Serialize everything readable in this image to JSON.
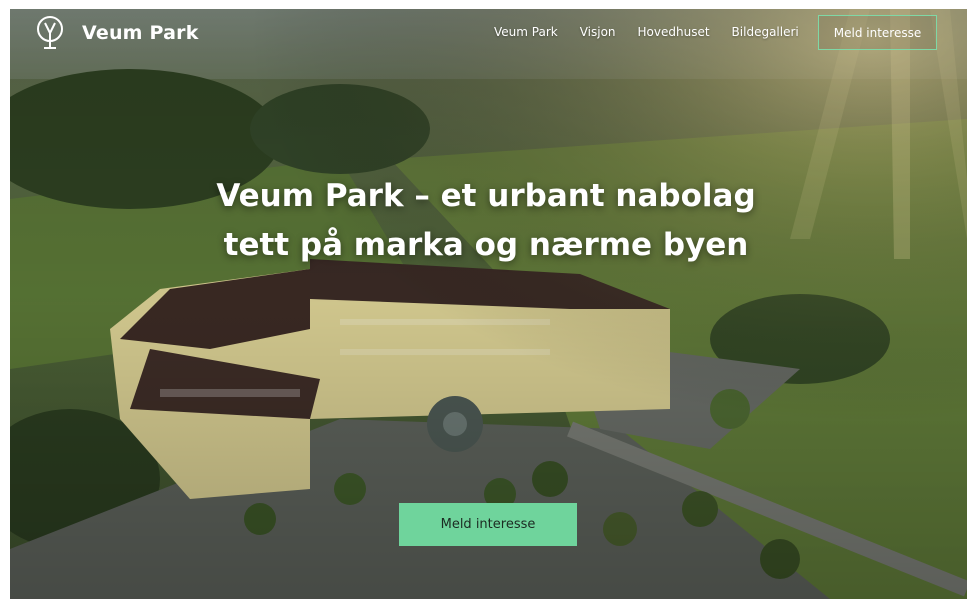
{
  "header": {
    "brand": "Veum Park",
    "nav": [
      {
        "label": "Veum Park"
      },
      {
        "label": "Visjon"
      },
      {
        "label": "Hovedhuset"
      },
      {
        "label": "Bildegalleri"
      }
    ],
    "cta_label": "Meld interesse"
  },
  "hero": {
    "headline": "Veum Park – et urbant nabolag tett på marka og nærme byen",
    "cta_label": "Meld interesse"
  },
  "colors": {
    "accent_green": "#6fd49c",
    "outline_green": "#7fd8a6"
  },
  "icons": {
    "logo": "tree-logo-icon"
  }
}
